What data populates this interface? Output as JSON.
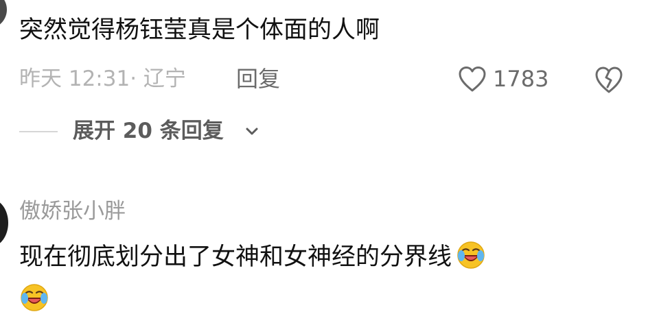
{
  "comment_1": {
    "text": "突然觉得杨钰莹真是个体面的人啊",
    "time_location": "昨天 12:31· 辽宁",
    "reply_label": "回复",
    "like_count": "1783",
    "icons": [
      "heart-outline-icon",
      "broken-heart-icon"
    ]
  },
  "replies": {
    "expand_label": "展开 20 条回复",
    "icon": "chevron-down-icon"
  },
  "comment_2": {
    "username": "傲娇张小胖",
    "text": "现在彻底划分出了女神和女神经的分界线",
    "emoji": "laughing-crying-emoji"
  },
  "colors": {
    "text_primary": "#111111",
    "text_meta": "#b3b3b3",
    "text_action": "#6b6b6b",
    "emoji_yellow": "#f7c325"
  }
}
